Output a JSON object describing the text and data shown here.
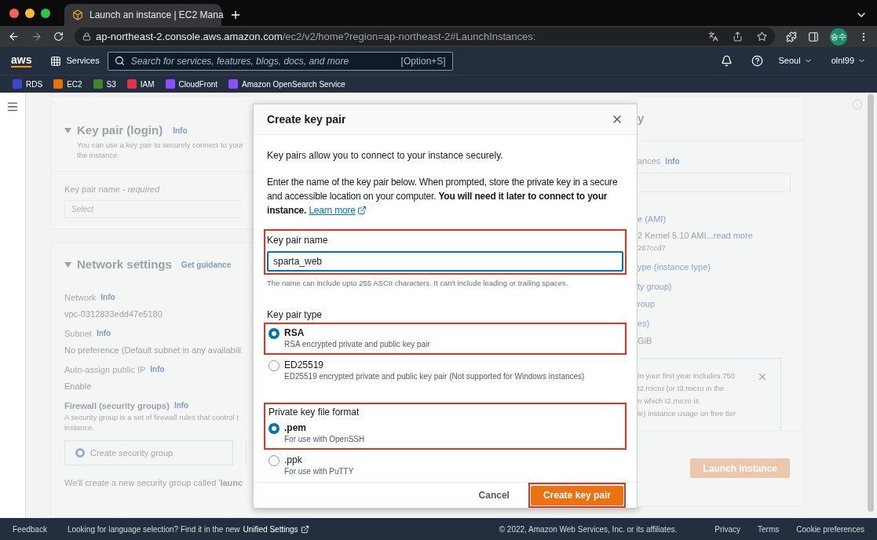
{
  "browser": {
    "tab_title": "Launch an instance | EC2 Mana",
    "url_host": "ap-northeast-2.console.aws.amazon.com",
    "url_path": "/ec2/v2/home?region=ap-northeast-2#LaunchInstances:",
    "profile_badge": "승수"
  },
  "aws_nav": {
    "logo": "aws",
    "services": "Services",
    "search_placeholder": "Search for services, features, blogs, docs, and more",
    "shortcut": "[Option+S]",
    "region": "Seoul",
    "account": "olnl99"
  },
  "favorites": [
    {
      "label": "RDS",
      "color": "#3b48cc"
    },
    {
      "label": "EC2",
      "color": "#ed7100"
    },
    {
      "label": "S3",
      "color": "#3f8624"
    },
    {
      "label": "IAM",
      "color": "#dd344c"
    },
    {
      "label": "CloudFront",
      "color": "#8c4fff"
    },
    {
      "label": "Amazon OpenSearch Service",
      "color": "#8c4fff"
    }
  ],
  "key_pair_section": {
    "title": "Key pair (login)",
    "info": "Info",
    "description": [
      "You can use a key pair to securely connect to your",
      "the instance."
    ],
    "name_label": "Key pair name - *required*",
    "select_placeholder": "Select"
  },
  "network_section": {
    "title": "Network settings",
    "guidance": "Get guidance",
    "fields": [
      {
        "label": "Network",
        "info": "Info",
        "value": "vpc-0312833edd47e5180"
      },
      {
        "label": "Subnet",
        "info": "Info",
        "value": "No preference (Default subnet in any availabili"
      },
      {
        "label": "Auto-assign public IP",
        "info": "Info",
        "value": "Enable"
      }
    ],
    "firewall": {
      "label": "Firewall (security groups)",
      "info": "Info",
      "description": [
        "A security group is a set of firewall rules that control t",
        "instance."
      ],
      "option": {
        "label": "Create security group",
        "selected": true
      },
      "note": "We'll create a new security group called '**launc**"
    }
  },
  "summary_section": {
    "heading": "y",
    "instances_label": "ances",
    "instances_info": "Info",
    "items": [
      {
        "label": "e (AMI)",
        "values": [
          "2 Kernel 5.10 AMI...",
          "267ccd7"
        ],
        "link": "read more"
      },
      {
        "label": "ype (instance type)"
      },
      {
        "label": "ty group)",
        "values": [
          "roup"
        ]
      },
      {
        "label": "es)",
        "values": [
          "GiB"
        ]
      }
    ],
    "free_tier": [
      "In your first year includes 750",
      "t2.micro (or t3.micro in the",
      "n which t2.micro is",
      "le) instance usage on free tier"
    ],
    "launch": "Launch instance"
  },
  "modal": {
    "title": "Create key pair",
    "intro": "Key pairs allow you to connect to your instance securely.",
    "instructions": "Enter the name of the key pair below. When prompted, store the private key in a secure and accessible location on your computer. **You will need it later to connect to your instance.**",
    "learn_more": "Learn more",
    "name_label": "Key pair name",
    "name_value": "sparta_web",
    "name_hint": "The name can include upto 255 ASCII characters. It can't include leading or trailing spaces.",
    "type_label": "Key pair type",
    "type_options": [
      {
        "label": "RSA",
        "description": "RSA encrypted private and public key pair",
        "selected": true
      },
      {
        "label": "ED25519",
        "description": "ED25519 encrypted private and public key pair (Not supported for Windows instances)",
        "selected": false
      }
    ],
    "format_label": "Private key file format",
    "format_options": [
      {
        "label": ".pem",
        "description": "For use with OpenSSH",
        "selected": true
      },
      {
        "label": ".ppk",
        "description": "For use with PuTTY",
        "selected": false
      }
    ],
    "cancel": "Cancel",
    "create": "Create key pair"
  },
  "footer": {
    "feedback": "Feedback",
    "language_note": "Looking for language selection? Find it in the new",
    "unified_settings": "Unified Settings",
    "copyright": "© 2022, Amazon Web Services, Inc. or its affiliates.",
    "links": [
      "Privacy",
      "Terms",
      "Cookie preferences"
    ]
  }
}
